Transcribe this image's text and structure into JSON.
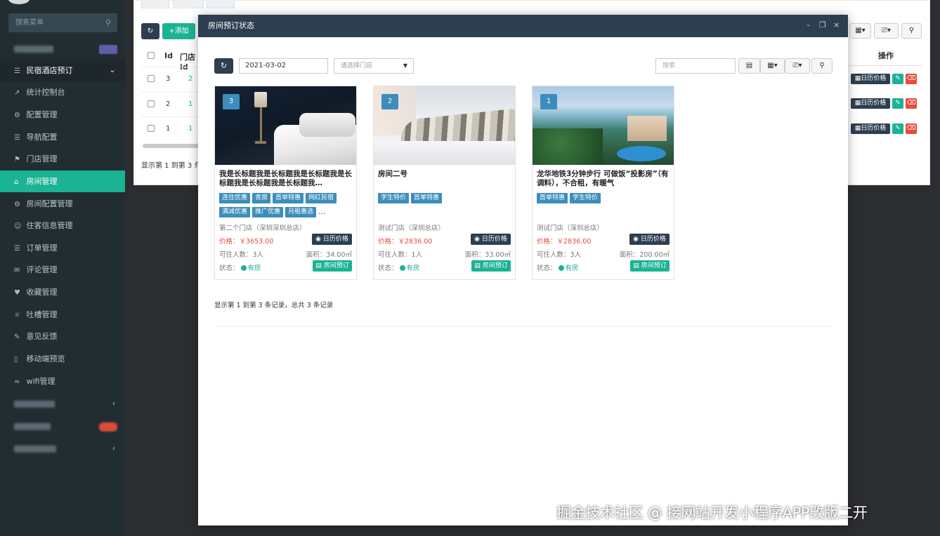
{
  "sidebar": {
    "search_placeholder": "搜索菜单",
    "items": [
      {
        "label": "民宿酒店预订",
        "icon": "list-icon"
      },
      {
        "label": "统计控制台",
        "icon": "chart-icon"
      },
      {
        "label": "配置管理",
        "icon": "gear-icon"
      },
      {
        "label": "导航配置",
        "icon": "list-icon"
      },
      {
        "label": "门店管理",
        "icon": "bank-icon"
      },
      {
        "label": "房间管理",
        "icon": "home-icon"
      },
      {
        "label": "房间配置管理",
        "icon": "gear-icon"
      },
      {
        "label": "住客信息管理",
        "icon": "user-icon"
      },
      {
        "label": "订单管理",
        "icon": "list-icon"
      },
      {
        "label": "评论管理",
        "icon": "comments-icon"
      },
      {
        "label": "收藏管理",
        "icon": "heart-icon"
      },
      {
        "label": "吐槽管理",
        "icon": "bulb-icon"
      },
      {
        "label": "意见反馈",
        "icon": "pencil-icon"
      },
      {
        "label": "移动端预览",
        "icon": "mobile-icon"
      },
      {
        "label": "wifi管理",
        "icon": "wifi-icon"
      }
    ]
  },
  "background": {
    "add_label": "添加",
    "columns": [
      "Id",
      "门店id"
    ],
    "rows": [
      {
        "id": "3",
        "store": "2"
      },
      {
        "id": "2",
        "store": "1"
      },
      {
        "id": "1",
        "store": "1"
      }
    ],
    "footer": "显示第 1 到第 3 条记录，总共 3 条记录",
    "op_header": "操作",
    "cal_label": "日历价格"
  },
  "modal": {
    "title": "房间预订状态",
    "date_value": "2021-03-02",
    "store_placeholder": "请选择门店",
    "search_placeholder": "搜索",
    "footer": "显示第 1 到第 3 条记录，总共 3 条记录",
    "labels": {
      "price": "价格：",
      "people": "可住人数：",
      "area": "面积：",
      "status": "状态：",
      "calendar": "日历价格",
      "book": "房间预订"
    },
    "cards": [
      {
        "num": "3",
        "title": "我是长标题我是长标题我是长标题我是长标题我是长标题我是长标题我…",
        "tags": [
          "连住优惠",
          "青旅",
          "首单特惠",
          "网红民宿",
          "满减优惠",
          "推广优惠",
          "月租惠选"
        ],
        "more": "…",
        "store": "第二个门店（深圳深圳总店）",
        "price": "￥3653.00",
        "people": "3人",
        "area": "34.00㎡",
        "status": "有房"
      },
      {
        "num": "2",
        "title": "房间二号",
        "tags": [
          "学生特价",
          "首单特惠"
        ],
        "more": "",
        "store": "测试门店（深圳总店）",
        "price": "￥2836.00",
        "people": "1人",
        "area": "33.00㎡",
        "status": "有房"
      },
      {
        "num": "1",
        "title": "龙华地铁3分钟步行 可做饭“投影房”（有调料），不合租，有暖气",
        "tags": [
          "首单特惠",
          "学生特价"
        ],
        "more": "",
        "store": "测试门店（深圳总店）",
        "price": "￥2836.00",
        "people": "3人",
        "area": "200.00㎡",
        "status": "有房"
      }
    ]
  },
  "watermark": "掘金技术社区 @ 接网站开发小程序APP改版二开",
  "colors": {
    "sidebar_bg": "#222d32",
    "accent_green": "#1ab394",
    "header_dark": "#2c3e50",
    "tag_blue": "#3c8dbc",
    "price_red": "#e74c3c"
  }
}
